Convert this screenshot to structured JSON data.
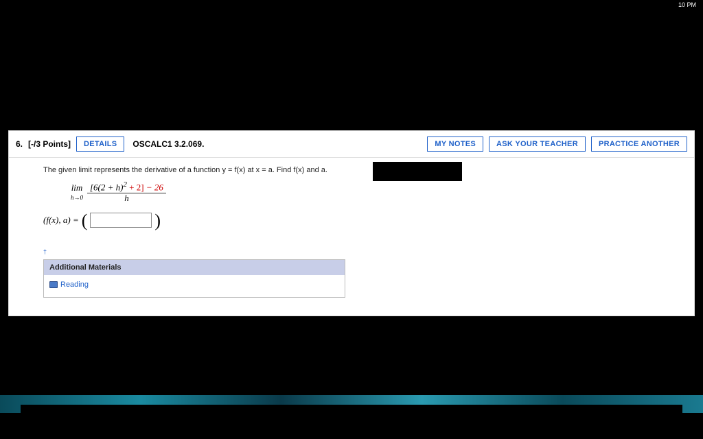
{
  "system": {
    "clock": "10 PM"
  },
  "question": {
    "number": "6.",
    "points": "[-/3 Points]",
    "details_btn": "DETAILS",
    "reference": "OSCALC1 3.2.069.",
    "my_notes": "MY NOTES",
    "ask_teacher": "ASK YOUR TEACHER",
    "practice_another": "PRACTICE ANOTHER",
    "prompt": "The given limit represents the derivative of a function y = f(x) at x = a. Find f(x) and a.",
    "limit": {
      "lim_label": "lim",
      "lim_sub": "h→0",
      "numerator_lead": "[6(2 + h)",
      "numerator_exp": "2",
      "numerator_tail_black": " + 2]",
      "numerator_tail_red": " − 26",
      "denominator": "h"
    },
    "answer_label": "(f(x), a) = ",
    "answer_value": ""
  },
  "additional": {
    "header": "Additional Materials",
    "reading": "Reading"
  }
}
